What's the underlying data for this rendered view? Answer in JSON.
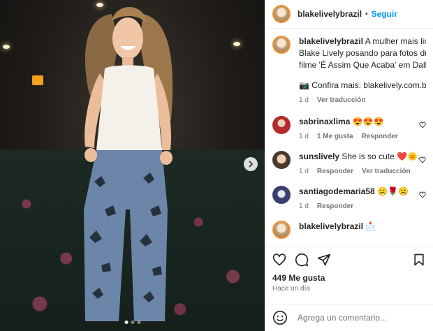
{
  "post": {
    "username": "blakelivelybrazil",
    "separator": "•",
    "follow_label": "Seguir",
    "caption_lines": [
      "A mulher mais linda",
      "Blake Lively posando para fotos duran",
      "filme 'É Assim Que Acaba' em Dallas."
    ],
    "caption_more": "📷 Confira mais: blakelively.com.br/g",
    "caption_time": "1 d",
    "caption_translate": "Ver traducción"
  },
  "comments": [
    {
      "user": "sabrinaxlima",
      "text": "😍😍😍",
      "time": "1 d",
      "likes": "1 Me gusta",
      "reply": "Responder"
    },
    {
      "user": "sunslively",
      "text": "She is so cute ❤️🌞.",
      "time": "1 d",
      "reply": "Responder",
      "translate": "Ver traducción"
    },
    {
      "user": "santiagodemaria58",
      "text": "☹️🌹☹️",
      "time": "1 d",
      "reply": "Responder"
    },
    {
      "user": "blakelivelybrazil",
      "text": "📩"
    }
  ],
  "actions": {
    "likes_count": "449 Me gusta",
    "timestamp": "Hace un día"
  },
  "composer": {
    "placeholder": "Agrega un comentario..."
  },
  "icons": [
    "heart-icon",
    "comment-icon",
    "share-icon",
    "bookmark-icon",
    "emoji-icon",
    "chevron-right-icon"
  ],
  "colors": {
    "accent": "#0095f6",
    "muted": "#737373",
    "text": "#262626"
  }
}
